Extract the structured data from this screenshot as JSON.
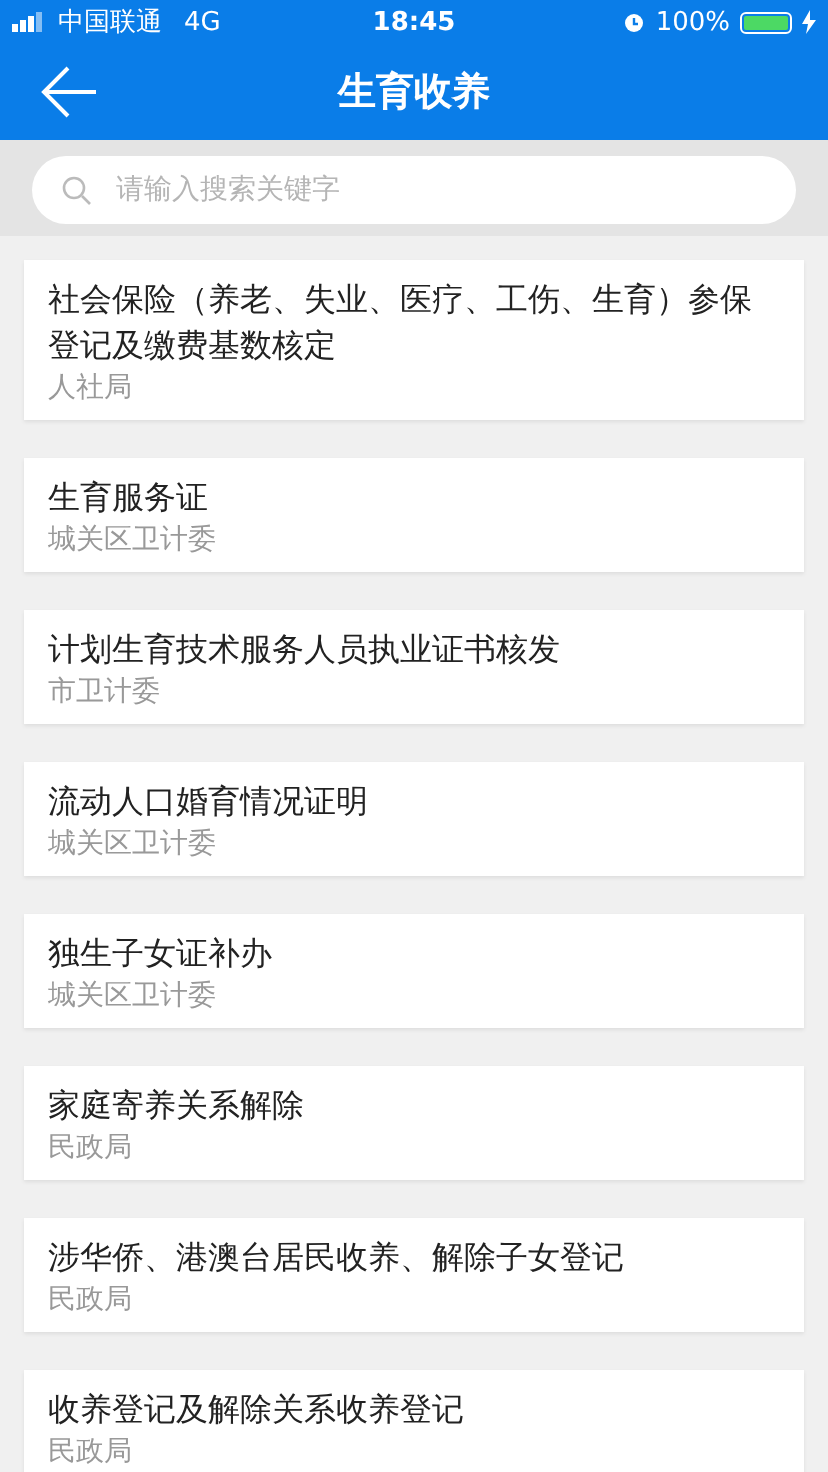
{
  "status_bar": {
    "carrier": "中国联通",
    "network": "4G",
    "time": "18:45",
    "battery": "100%"
  },
  "header": {
    "title": "生育收养"
  },
  "search": {
    "placeholder": "请输入搜索关键字"
  },
  "items": [
    {
      "title": "社会保险（养老、失业、医疗、工伤、生育）参保登记及缴费基数核定",
      "department": "人社局"
    },
    {
      "title": "生育服务证",
      "department": "城关区卫计委"
    },
    {
      "title": "计划生育技术服务人员执业证书核发",
      "department": "市卫计委"
    },
    {
      "title": "流动人口婚育情况证明",
      "department": "城关区卫计委"
    },
    {
      "title": "独生子女证补办",
      "department": "城关区卫计委"
    },
    {
      "title": "家庭寄养关系解除",
      "department": "民政局"
    },
    {
      "title": "涉华侨、港澳台居民收养、解除子女登记",
      "department": "民政局"
    },
    {
      "title": "收养登记及解除关系收养登记",
      "department": "民政局"
    }
  ]
}
